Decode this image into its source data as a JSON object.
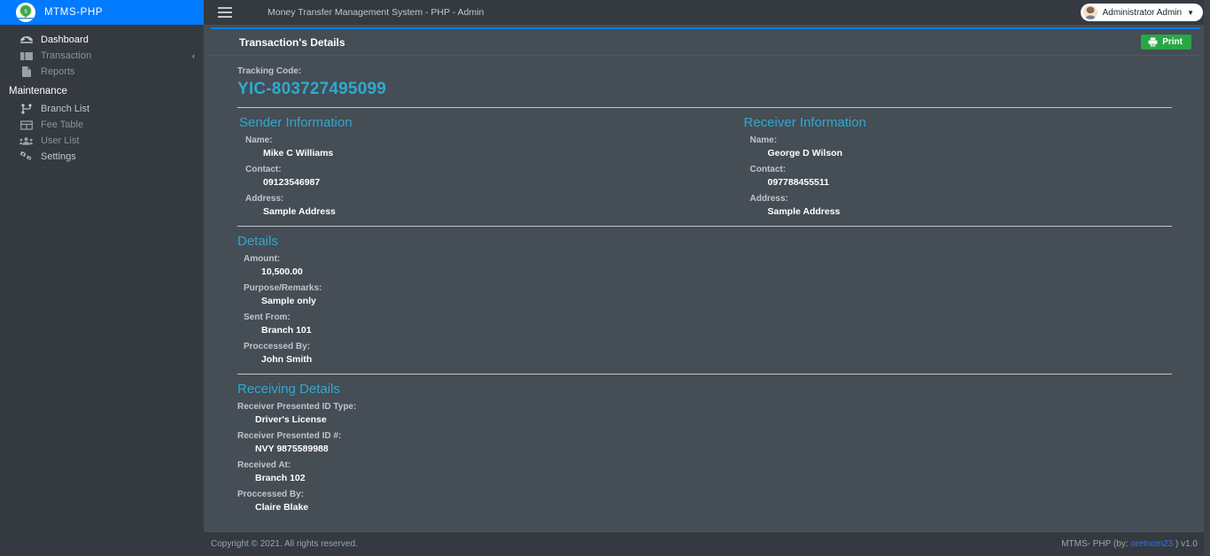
{
  "brand": {
    "logo_icon": "money-transfer-logo-icon",
    "text": "MTMS-PHP"
  },
  "sidebar": {
    "items": [
      {
        "label": "Dashboard",
        "icon": "dashboard-icon"
      },
      {
        "label": "Transaction",
        "icon": "transaction-icon",
        "arrow": "‹"
      },
      {
        "label": "Reports",
        "icon": "reports-icon"
      }
    ],
    "section_header": "Maintenance",
    "maintenance_items": [
      {
        "label": "Branch List",
        "icon": "branch-icon"
      },
      {
        "label": "Fee Table",
        "icon": "table-icon"
      },
      {
        "label": "User List",
        "icon": "users-icon"
      },
      {
        "label": "Settings",
        "icon": "gear-icon"
      }
    ]
  },
  "topbar": {
    "menu_icon": "hamburger-icon",
    "title": "Money Transfer Management System - PHP - Admin",
    "user_name": "Administrator Admin",
    "caret_icon": "chevron-down-icon",
    "avatar_icon": "user-avatar-icon"
  },
  "card": {
    "title": "Transaction's Details",
    "print_label": "Print",
    "print_icon": "printer-icon"
  },
  "tracking": {
    "label": "Tracking Code:",
    "code": "YIC-803727495099"
  },
  "sender": {
    "title": "Sender Information",
    "name_label": "Name:",
    "name": "Mike C Williams",
    "contact_label": "Contact:",
    "contact": "09123546987",
    "address_label": "Address:",
    "address": "Sample Address"
  },
  "receiver": {
    "title": "Receiver Information",
    "name_label": "Name:",
    "name": "George D Wilson",
    "contact_label": "Contact:",
    "contact": "097788455511",
    "address_label": "Address:",
    "address": "Sample Address"
  },
  "details": {
    "title": "Details",
    "amount_label": "Amount:",
    "amount": "10,500.00",
    "purpose_label": "Purpose/Remarks:",
    "purpose": "Sample only",
    "sent_from_label": "Sent From:",
    "sent_from": "Branch 101",
    "processed_by_label": "Proccessed By:",
    "processed_by": "John Smith"
  },
  "receiving": {
    "title": "Receiving Details",
    "id_type_label": "Receiver Presented ID Type:",
    "id_type": "Driver's License",
    "id_num_label": "Receiver Presented ID #:",
    "id_num": "NVY 9875589988",
    "received_at_label": "Received At:",
    "received_at": "Branch 102",
    "processed_by_label": "Proccessed By:",
    "processed_by": "Claire Blake"
  },
  "footer": {
    "copyright": "Copyright © 2021. All rights reserved.",
    "right_prefix": "MTMS- PHP (by:",
    "right_link": "oretnom23",
    "right_suffix": ") v1.0"
  },
  "colors": {
    "brand_blue": "#007bff",
    "accent_cyan": "#31a8cf",
    "print_green": "#28a745",
    "sidebar_bg": "#343a40",
    "content_bg": "#454d55",
    "link_blue": "#2b78e4"
  }
}
